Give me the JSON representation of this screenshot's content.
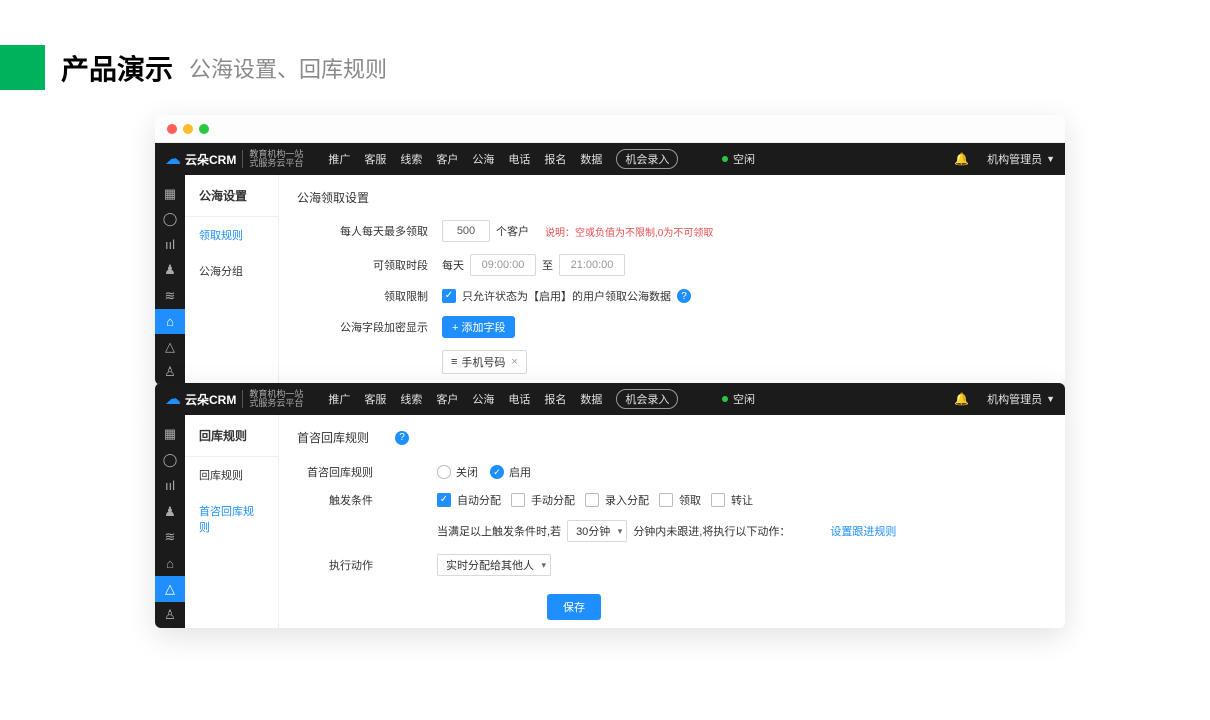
{
  "page": {
    "title": "产品演示",
    "subtitle": "公海设置、回库规则"
  },
  "logo": {
    "brand": "云朵CRM",
    "tagline1": "教育机构一站",
    "tagline2": "式服务云平台"
  },
  "topnav": {
    "items": [
      "推广",
      "客服",
      "线索",
      "客户",
      "公海",
      "电话",
      "报名",
      "数据"
    ],
    "cta": "机会录入",
    "status": "空闲",
    "user": "机构管理员"
  },
  "win1": {
    "sideTitle": "公海设置",
    "sideItems": [
      "领取规则",
      "公海分组"
    ],
    "contentTitle": "公海领取设置",
    "labels": {
      "limit": "每人每天最多领取",
      "unit": "个客户",
      "note": "说明：空或负值为不限制,0为不可领取",
      "period": "可领取时段",
      "daily": "每天",
      "to": "至",
      "restrict": "领取限制",
      "restrictText": "只允许状态为【启用】的用户领取公海数据",
      "encrypt": "公海字段加密显示",
      "addField": "+ 添加字段",
      "tagPhone": "手机号码",
      "tagIcon": "≡"
    },
    "values": {
      "limit": "500",
      "timeFrom": "09:00:00",
      "timeTo": "21:00:00"
    }
  },
  "win2": {
    "sideTitle": "回库规则",
    "sideItems": [
      "回库规则",
      "首咨回库规则"
    ],
    "contentTitle": "首咨回库规则",
    "labels": {
      "rule": "首咨回库规则",
      "off": "关闭",
      "on": "启用",
      "trigger": "触发条件",
      "opts": [
        "自动分配",
        "手动分配",
        "录入分配",
        "领取",
        "转让"
      ],
      "cond1": "当满足以上触发条件时,若",
      "cond2": "分钟内未跟进,将执行以下动作：",
      "followLink": "设置跟进规则",
      "action": "执行动作",
      "actionSel": "实时分配给其他人",
      "timeSel": "30分钟",
      "save": "保存"
    }
  }
}
